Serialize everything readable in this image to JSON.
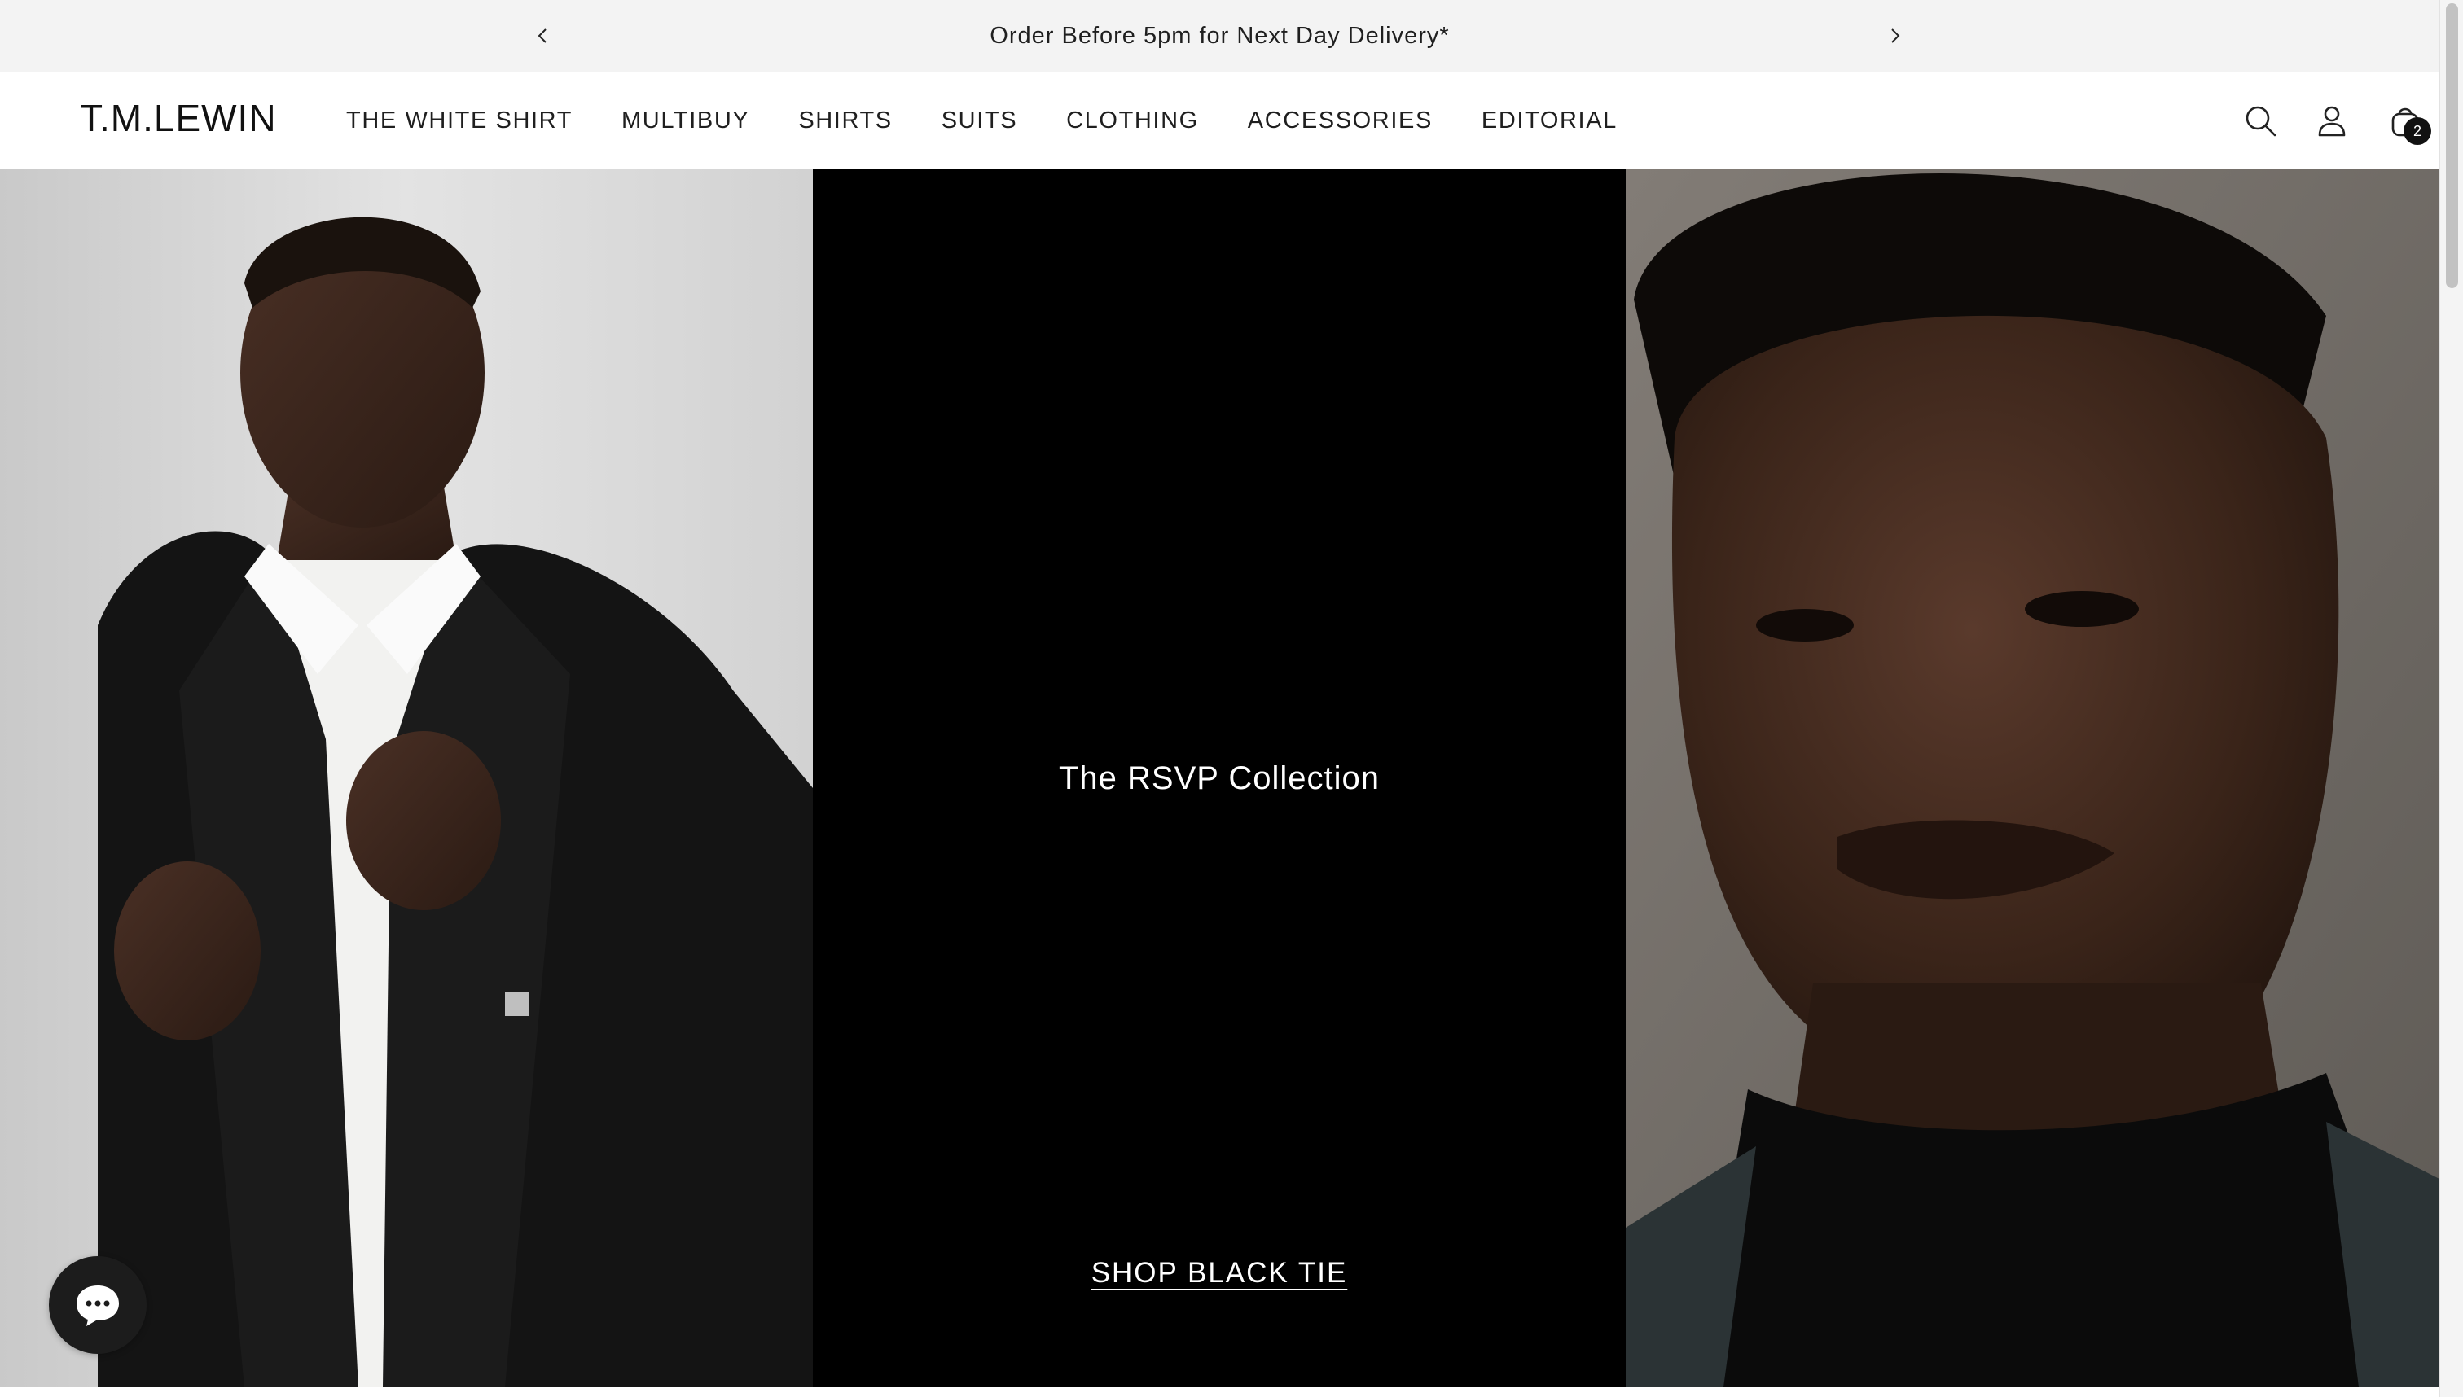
{
  "announcement": {
    "text": "Order Before 5pm for Next Day Delivery*",
    "prev_icon": "chevron-left-icon",
    "next_icon": "chevron-right-icon"
  },
  "header": {
    "logo": "T.M.LEWIN",
    "nav": [
      {
        "label": "THE WHITE SHIRT"
      },
      {
        "label": "MULTIBUY"
      },
      {
        "label": "SHIRTS"
      },
      {
        "label": "SUITS"
      },
      {
        "label": "CLOTHING"
      },
      {
        "label": "ACCESSORIES"
      },
      {
        "label": "EDITORIAL"
      }
    ],
    "icons": [
      "search-icon",
      "account-icon",
      "cart-icon"
    ],
    "cart_count": "2"
  },
  "hero": {
    "title": "The RSVP Collection",
    "cta": "SHOP BLACK TIE"
  },
  "chat": {
    "icon": "chat-icon"
  },
  "colors": {
    "announcement_bg": "#f3f3f3",
    "hero_mid_bg": "#000000",
    "text_dark": "#1f1f1f",
    "text_light": "#ffffff"
  }
}
